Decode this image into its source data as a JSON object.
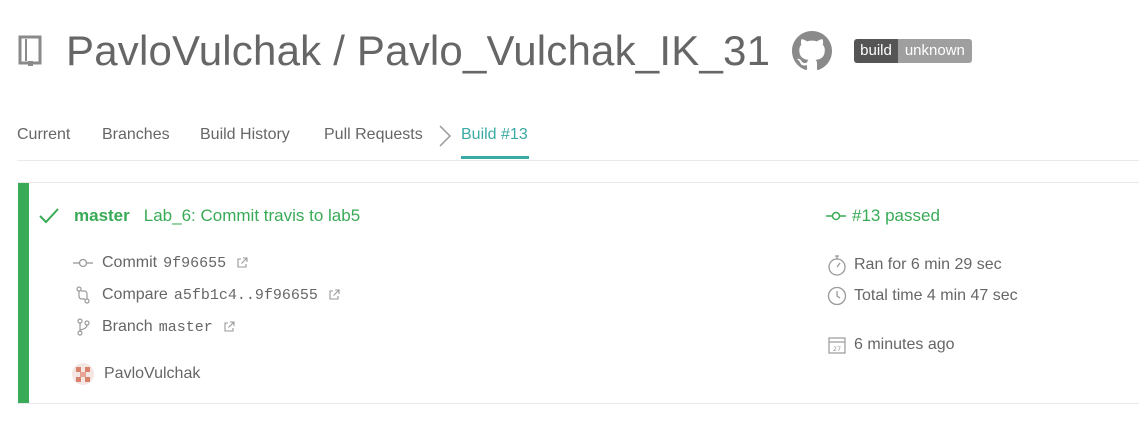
{
  "header": {
    "repo_title": "PavloVulchak / Pavlo_Vulchak_IK_31",
    "badge_left": "build",
    "badge_right": "unknown"
  },
  "tabs": {
    "current": "Current",
    "branches": "Branches",
    "build_history": "Build History",
    "pull_requests": "Pull Requests",
    "build": "Build #13"
  },
  "build": {
    "branch": "master",
    "commit_message": "Lab_6: Commit travis to lab5",
    "status_text": "#13 passed",
    "commit_label": "Commit",
    "commit_sha": "9f96655",
    "compare_label": "Compare",
    "compare_range": "a5fb1c4..9f96655",
    "branch_label": "Branch",
    "branch_value": "master",
    "author": "PavloVulchak",
    "ran_for": "Ran for 6 min 29 sec",
    "total_time": "Total time 4 min 47 sec",
    "finished": "6 minutes ago"
  },
  "colors": {
    "passed": "#39aa56",
    "accent": "#39aaa4",
    "text": "#666666"
  },
  "icons": {
    "repo": "repo-book-icon",
    "github": "github-icon",
    "check": "check-icon",
    "commit": "commit-icon",
    "compare": "compare-icon",
    "branch": "branch-icon",
    "external": "external-link-icon",
    "stopwatch": "stopwatch-icon",
    "clock": "clock-icon",
    "calendar": "calendar-icon"
  }
}
